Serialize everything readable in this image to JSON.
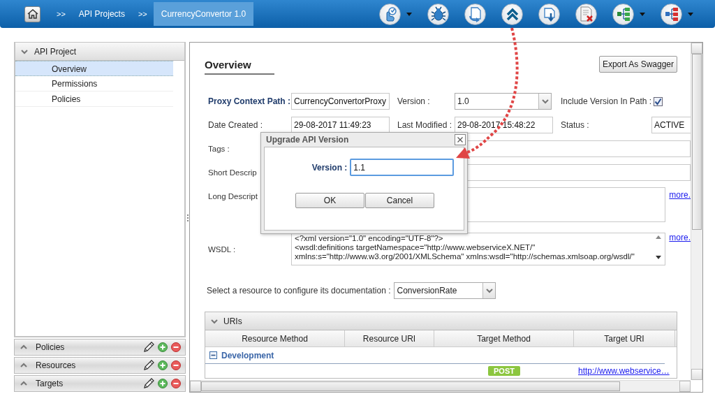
{
  "breadcrumb": [
    {
      "separator": ">>",
      "label": "API Projects",
      "selected": false
    },
    {
      "separator": ">>",
      "label": "CurrencyConvertor 1.0",
      "selected": true
    }
  ],
  "toolbar": [
    {
      "kind": "touch",
      "menu": true
    },
    {
      "kind": "bug",
      "menu": false
    },
    {
      "kind": "refresh",
      "menu": false
    },
    {
      "kind": "upgrade",
      "menu": false
    },
    {
      "kind": "download",
      "menu": false
    },
    {
      "kind": "delete",
      "menu": false
    },
    {
      "kind": "tree-green",
      "menu": true
    },
    {
      "kind": "tree-red",
      "menu": true
    }
  ],
  "sidebar": {
    "title": "API Project",
    "expanded": true,
    "items": [
      {
        "label": "Overview",
        "selected": true
      },
      {
        "label": "Permissions",
        "selected": false
      },
      {
        "label": "Policies",
        "selected": false
      }
    ],
    "sections": [
      {
        "title": "Policies",
        "expanded": false
      },
      {
        "title": "Resources",
        "expanded": false
      },
      {
        "title": "Targets",
        "expanded": false
      }
    ]
  },
  "overview": {
    "title": "Overview",
    "export_button": "Export As Swagger",
    "rows": [
      [
        {
          "label": "Proxy Context Path :",
          "bold": true,
          "kind": "text",
          "value": "CurrencyConvertorProxy"
        },
        {
          "label": "Version :",
          "kind": "select",
          "value": "1.0"
        },
        {
          "label": "Include Version In Path :",
          "kind": "checkbox",
          "checked": true
        }
      ],
      [
        {
          "label": "Date Created :",
          "kind": "text",
          "value": "29-08-2017 11:49:23"
        },
        {
          "label": "Last Modified :",
          "kind": "text",
          "value": "29-08-2017 15:48:22"
        },
        {
          "label": "Status :",
          "kind": "text",
          "value": "ACTIVE"
        }
      ]
    ],
    "wide_rows": [
      {
        "label": "Tags :",
        "kind": "text"
      },
      {
        "label": "Short Descrip",
        "kind": "text"
      },
      {
        "label": "Long Descript",
        "kind": "textarea",
        "link": "more."
      },
      {
        "label": "WSDL :",
        "kind": "code",
        "link": "more.",
        "lines": [
          "<?xml version=\"1.0\" encoding=\"UTF-8\"?>",
          "<wsdl:definitions targetNamespace=\"http://www.webserviceX.NET/\"",
          "xmlns:s=\"http://www.w3.org/2001/XMLSchema\" xmlns:wsdl=\"http://schemas.xmlsoap.org/wsdl/\""
        ]
      }
    ],
    "resource_select": {
      "label": "Select a resource to configure its documentation :",
      "value": "ConversionRate"
    }
  },
  "uris": {
    "title": "URIs",
    "expanded": true,
    "columns": [
      "Resource Method",
      "Resource URI",
      "Target Method",
      "Target URI"
    ],
    "groups": [
      {
        "name": "Development",
        "expanded": true,
        "rows": [
          {
            "target_method": "POST",
            "target_uri": "http://www.webservice…"
          }
        ]
      }
    ]
  },
  "dialog": {
    "title": "Upgrade API Version",
    "field_label": "Version :",
    "value": "1.1",
    "buttons": [
      "OK",
      "Cancel"
    ]
  }
}
